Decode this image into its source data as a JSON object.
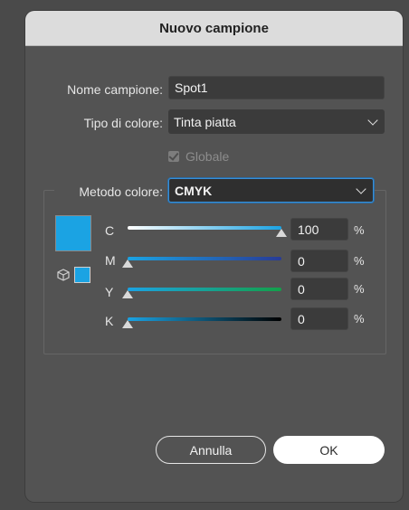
{
  "dialog": {
    "title": "Nuovo campione"
  },
  "form": {
    "name_label": "Nome campione:",
    "name_value": "Spot1",
    "color_type_label": "Tipo di colore:",
    "color_type_value": "Tinta piatta",
    "global_label": "Globale",
    "global_checked": true,
    "color_mode_label": "Metodo colore:",
    "color_mode_value": "CMYK"
  },
  "swatch": {
    "color": "#1ba3e3"
  },
  "sliders": [
    {
      "channel": "C",
      "value": "100",
      "unit": "%",
      "fraction": 1.0
    },
    {
      "channel": "M",
      "value": "0",
      "unit": "%",
      "fraction": 0.0
    },
    {
      "channel": "Y",
      "value": "0",
      "unit": "%",
      "fraction": 0.0
    },
    {
      "channel": "K",
      "value": "0",
      "unit": "%",
      "fraction": 0.0
    }
  ],
  "buttons": {
    "cancel_label": "Annulla",
    "ok_label": "OK"
  },
  "icons": {
    "out_of_gamut": "cube-icon",
    "dropdown": "chevron-down-icon",
    "check": "checkmark-icon"
  }
}
